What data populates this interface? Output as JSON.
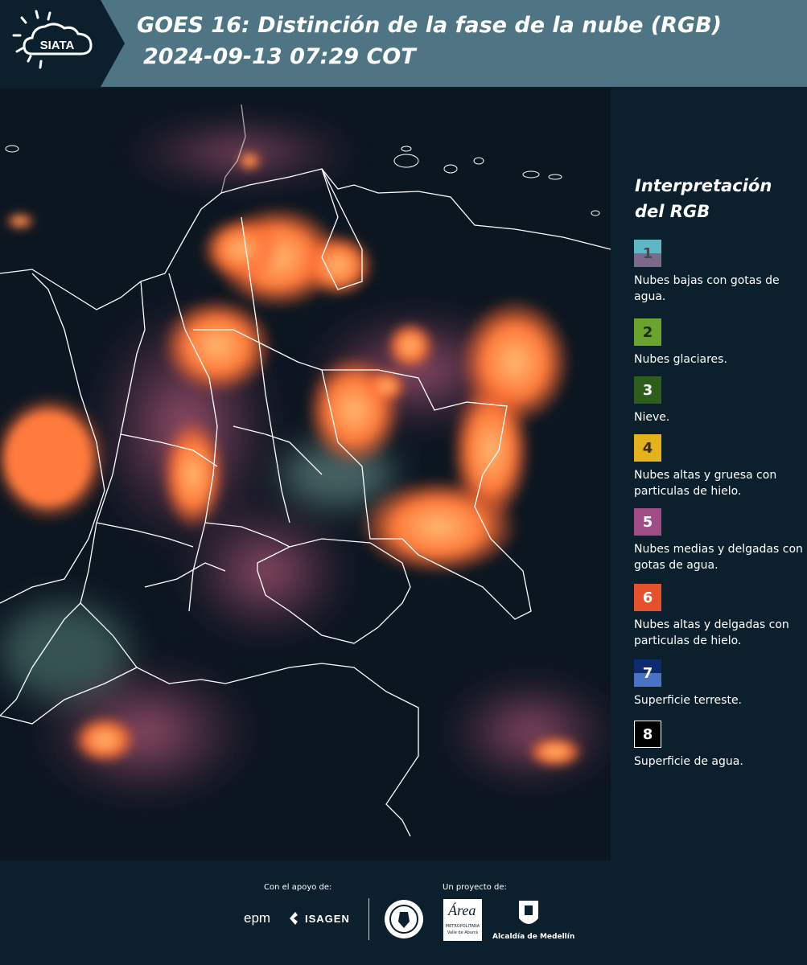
{
  "header": {
    "title_line1": "GOES 16: Distinción de la fase de la nube (RGB)",
    "title_line2": "2024-09-13 07:29 COT",
    "logo_text": "SIATA"
  },
  "legend": {
    "title": "Interpretación del RGB",
    "items": [
      {
        "number": "1",
        "label": "Nubes bajas con gotas de agua.",
        "color_top": "#5fb7c6",
        "color_bottom": "#7b6a8b"
      },
      {
        "number": "2",
        "label": "Nubes glaciares.",
        "color": "#6aa42f"
      },
      {
        "number": "3",
        "label": "Nieve.",
        "color": "#2f5d1c"
      },
      {
        "number": "4",
        "label": "Nubes altas y gruesa con particulas de hielo.",
        "color": "#e3b21c"
      },
      {
        "number": "5",
        "label": "Nubes medias y delgadas con gotas de agua.",
        "color": "#a04c86"
      },
      {
        "number": "6",
        "label": "Nubes altas y delgadas con particulas de hielo.",
        "color": "#e4512b"
      },
      {
        "number": "7",
        "label": "Superficie terreste.",
        "color_top": "#0d2b6e",
        "color_bottom": "#4a72c5"
      },
      {
        "number": "8",
        "label": "Superficie de agua.",
        "color": "#000000"
      }
    ]
  },
  "footer": {
    "support_label": "Con el apoyo de:",
    "project_label": "Un proyecto de:",
    "sponsor_epm": "epm",
    "sponsor_isagen": "ISAGEN",
    "area_logo_text": "Área",
    "area_subtext": "METROPOLITANA",
    "area_subtext2": "Valle de Aburrá",
    "alcaldia_label": "Alcaldía de Medellín"
  }
}
